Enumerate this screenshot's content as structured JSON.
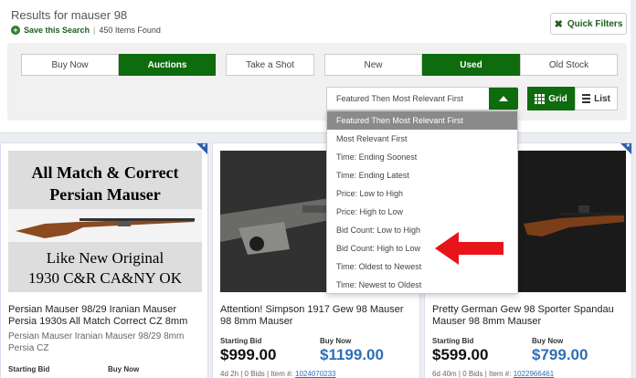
{
  "header": {
    "results_title": "Results for mauser 98",
    "save_search": "Save this Search",
    "items_found": "450 Items Found",
    "quick_filters": "Quick Filters"
  },
  "filters": {
    "listing_type": [
      "Buy Now",
      "Auctions",
      "Take a Shot"
    ],
    "listing_type_active": "Auctions",
    "condition": [
      "New",
      "Used",
      "Old Stock"
    ],
    "condition_active": "Used"
  },
  "sort": {
    "selected": "Featured Then Most Relevant First",
    "options": [
      "Featured Then Most Relevant First",
      "Most Relevant First",
      "Time: Ending Soonest",
      "Time: Ending Latest",
      "Price: Low to High",
      "Price: High to Low",
      "Bid Count: Low to High",
      "Bid Count: High to Low",
      "Time: Oldest to Newest",
      "Time: Newest to Oldest"
    ]
  },
  "view": {
    "grid": "Grid",
    "list": "List",
    "active": "Grid"
  },
  "cards": [
    {
      "image_text": [
        "All Match & Correct",
        "Persian Mauser",
        "Like New Original",
        "1930 C&R CA&NY OK"
      ],
      "title": "Persian Mauser 98/29 Iranian Mauser Persia 1930s All Match Correct CZ 8mm",
      "subtitle": "Persian Mauser Iranian Mauser 98/29 8mm Persia CZ",
      "bid_label": "Starting Bid",
      "buy_label": "Buy Now"
    },
    {
      "title": "Attention! Simpson 1917 Gew 98 Mauser 98 8mm Mauser",
      "bid_label": "Starting Bid",
      "bid_price": "$999.00",
      "buy_label": "Buy Now",
      "buy_price": "$1199.00",
      "meta": "4d 2h | 0 Bids",
      "item_label": "Item #:",
      "item_number": "1024070233"
    },
    {
      "title": "Pretty German Gew 98 Sporter Spandau Mauser 98 8mm Mauser",
      "bid_label": "Starting Bid",
      "bid_price": "$599.00",
      "buy_label": "Buy Now",
      "buy_price": "$799.00",
      "meta": "6d 40m | 0 Bids",
      "item_label": "Item #:",
      "item_number": "1022966461"
    }
  ],
  "colors": {
    "accent_green": "#0e6b0e",
    "price_blue": "#2f6fb6",
    "arrow_red": "#e8141c"
  }
}
